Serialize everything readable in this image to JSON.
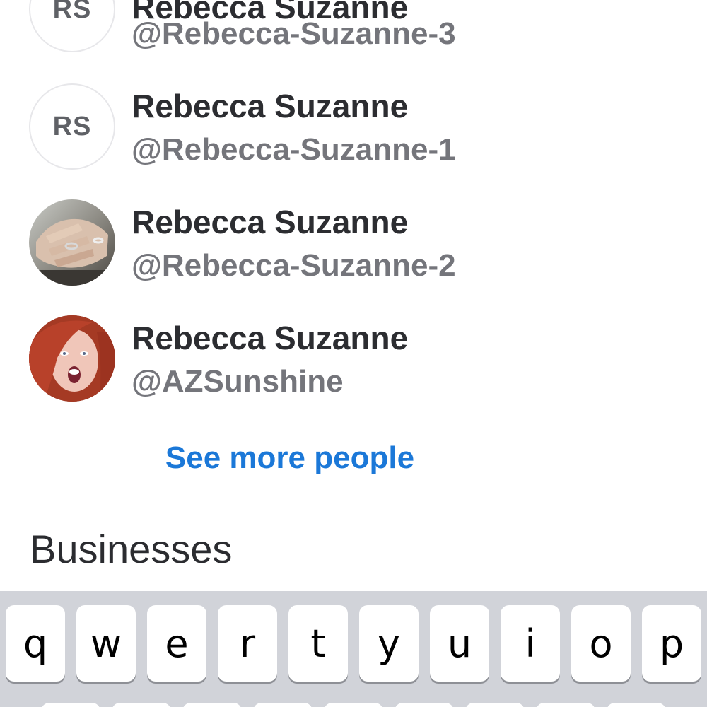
{
  "people": [
    {
      "name": "Rebecca Suzanne",
      "handle": "@Rebecca-Suzanne-3",
      "avatar": {
        "type": "initials",
        "text": "RS"
      }
    },
    {
      "name": "Rebecca Suzanne",
      "handle": "@Rebecca-Suzanne-1",
      "avatar": {
        "type": "initials",
        "text": "RS"
      }
    },
    {
      "name": "Rebecca Suzanne",
      "handle": "@Rebecca-Suzanne-2",
      "avatar": {
        "type": "photo",
        "subject": "hands-with-ring"
      }
    },
    {
      "name": "Rebecca Suzanne",
      "handle": "@AZSunshine",
      "avatar": {
        "type": "photo",
        "subject": "red-haired-woman"
      }
    }
  ],
  "see_more_label": "See more people",
  "businesses_heading": "Businesses",
  "keyboard": {
    "row1": [
      "q",
      "w",
      "e",
      "r",
      "t",
      "y",
      "u",
      "i",
      "o",
      "p"
    ]
  },
  "colors": {
    "link": "#1b78d8",
    "name_text": "#2c2d31",
    "handle_text": "#74757b",
    "keyboard_bg": "#d1d3d9",
    "key_bg": "#ffffff"
  }
}
